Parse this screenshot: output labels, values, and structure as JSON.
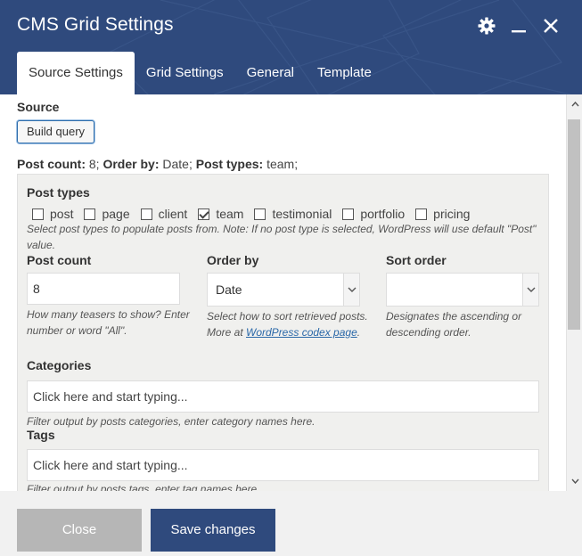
{
  "dialog": {
    "title": "CMS Grid Settings",
    "icons": [
      "gear-icon",
      "minimize-icon",
      "close-icon"
    ]
  },
  "tabs": [
    {
      "label": "Source Settings",
      "active": true
    },
    {
      "label": "Grid Settings",
      "active": false
    },
    {
      "label": "General",
      "active": false
    },
    {
      "label": "Template",
      "active": false
    }
  ],
  "source": {
    "label": "Source",
    "build_query_label": "Build query",
    "summary": {
      "post_count_key": "Post count:",
      "post_count_val": " 8; ",
      "order_by_key": "Order by:",
      "order_by_val": " Date; ",
      "post_types_key": "Post types:",
      "post_types_val": " team;"
    }
  },
  "post_types": {
    "label": "Post types",
    "options": [
      {
        "label": "post",
        "checked": false
      },
      {
        "label": "page",
        "checked": false
      },
      {
        "label": "client",
        "checked": false
      },
      {
        "label": "team",
        "checked": true
      },
      {
        "label": "testimonial",
        "checked": false
      },
      {
        "label": "portfolio",
        "checked": false
      },
      {
        "label": "pricing",
        "checked": false
      }
    ],
    "help": "Select post types to populate posts from. Note: If no post type is selected, WordPress will use default \"Post\" value."
  },
  "post_count": {
    "label": "Post count",
    "value": "8",
    "help": "How many teasers to show? Enter number or word \"All\"."
  },
  "order_by": {
    "label": "Order by",
    "value": "Date",
    "help_prefix": "Select how to sort retrieved posts. More at ",
    "help_link": "WordPress codex page",
    "help_suffix": "."
  },
  "sort_order": {
    "label": "Sort order",
    "value": "",
    "help": "Designates the ascending or descending order."
  },
  "categories": {
    "label": "Categories",
    "placeholder": "Click here and start typing...",
    "help": "Filter output by posts categories, enter category names here."
  },
  "tags": {
    "label": "Tags",
    "placeholder": "Click here and start typing...",
    "help": "Filter output by posts tags, enter tag names here."
  },
  "footer": {
    "close_label": "Close",
    "save_label": "Save changes"
  },
  "colors": {
    "header_bg": "#2f4a7d",
    "save_bg": "#2f4a7d",
    "close_bg": "#b6b6b6",
    "panel_bg": "#f0f0ee",
    "link": "#2a68a8"
  }
}
